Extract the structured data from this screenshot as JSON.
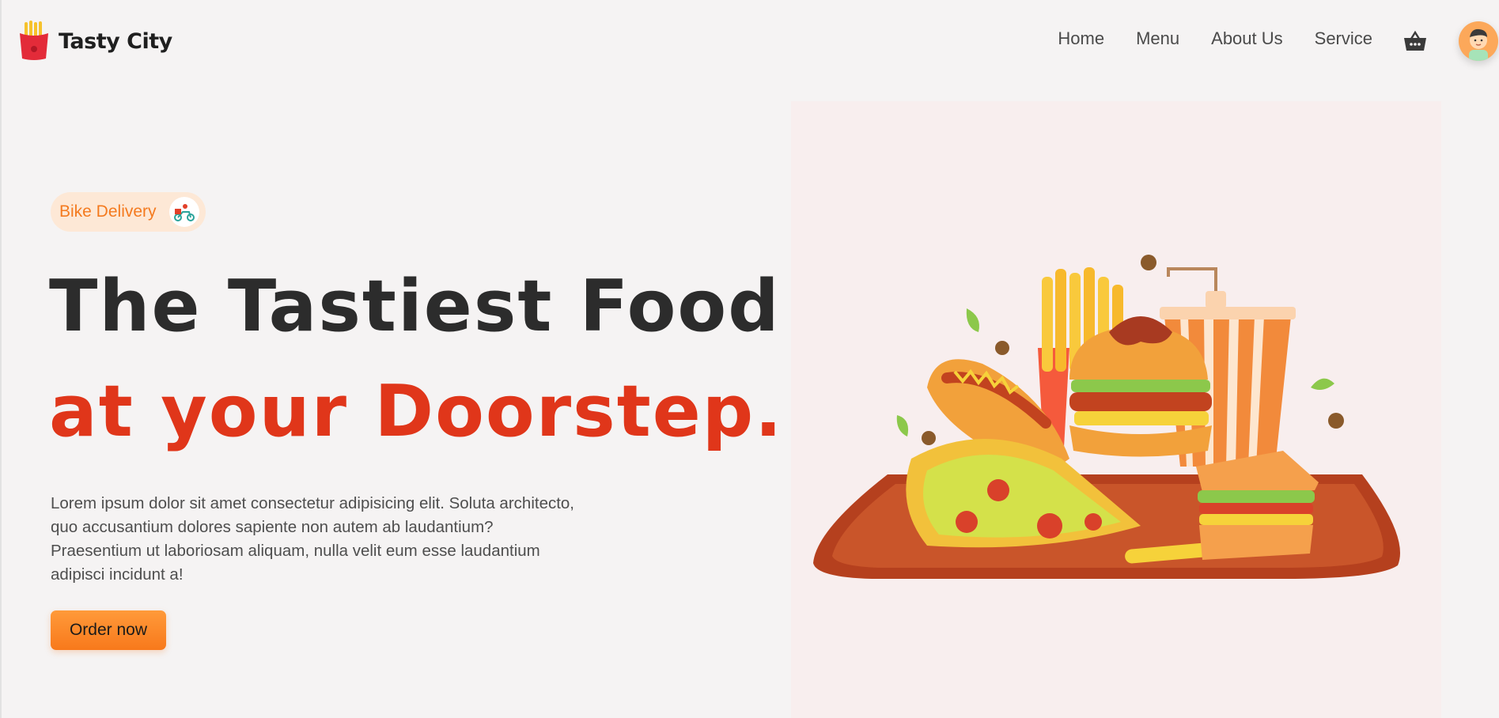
{
  "brand": {
    "name": "Tasty City",
    "logo_icon": "fries-logo-icon"
  },
  "nav": {
    "items": [
      {
        "label": "Home"
      },
      {
        "label": "Menu"
      },
      {
        "label": "About Us"
      },
      {
        "label": "Service"
      }
    ],
    "cart_icon": "basket-icon",
    "avatar_icon": "user-avatar-icon"
  },
  "hero": {
    "badge": {
      "label": "Bike Delivery",
      "icon": "scooter-delivery-icon"
    },
    "headline": "The Tastiest Food",
    "headline_accent": "at your Doorstep.",
    "description": "Lorem ipsum dolor sit amet consectetur adipisicing elit. Soluta architecto, quo accusantium dolores sapiente non autem ab laudantium? Praesentium ut laboriosam aliquam, nulla velit eum esse laudantium adipisci incidunt a!",
    "cta_label": "Order now",
    "illustration": "fast-food-tray-illustration"
  },
  "colors": {
    "accent": "#f47a1f",
    "headline_red": "#e0361a",
    "cta_orange": "#ff8a2a",
    "background": "#f5f3f3"
  }
}
